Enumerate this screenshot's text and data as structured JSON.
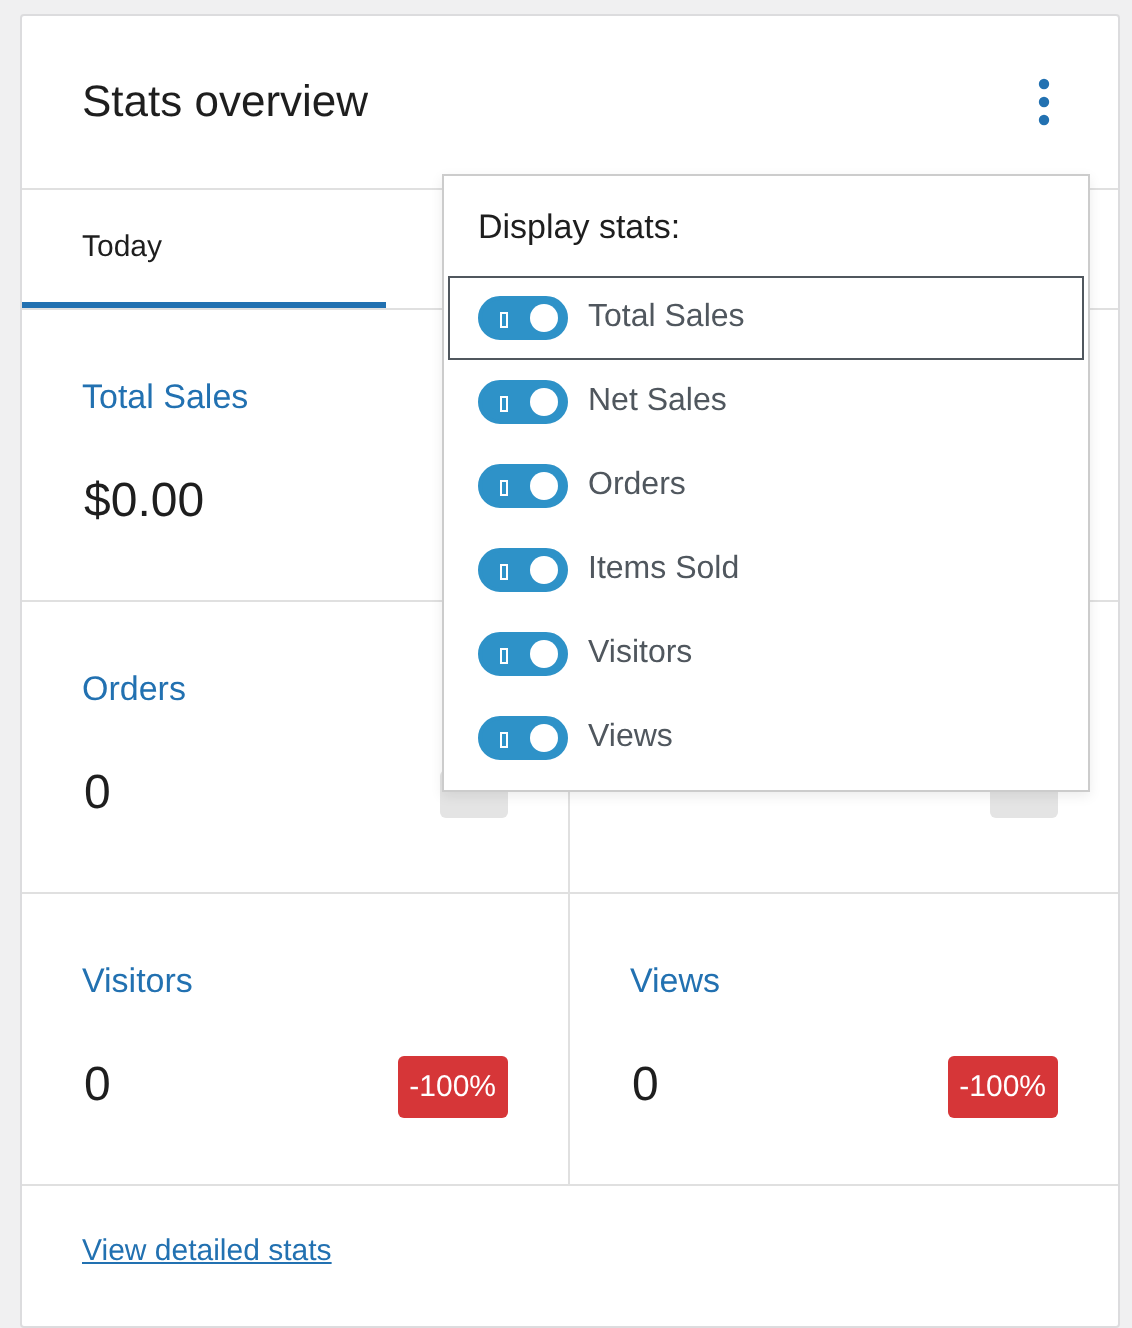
{
  "header": {
    "title": "Stats overview"
  },
  "tabs": [
    {
      "label": "Today",
      "selected": true
    }
  ],
  "stat_rows": [
    [
      {
        "label": "Total Sales",
        "value": "$0.00"
      }
    ],
    [
      {
        "label": "Orders",
        "value": "0",
        "color": "#e4e4e4"
      },
      {
        "color": "#e4e4e4"
      }
    ],
    [
      {
        "label": "Visitors",
        "value": "0",
        "badge": "-100%",
        "color": "#d63638"
      },
      {
        "label": "Views",
        "value": "0",
        "badge": "-100%",
        "color": "#d63638"
      }
    ]
  ],
  "footer_link": "View detailed stats",
  "menu": {
    "title": "Display stats:",
    "options": [
      {
        "label": "Total Sales",
        "on": true,
        "focused": true
      },
      {
        "label": "Net Sales",
        "on": true,
        "focused": false
      },
      {
        "label": "Orders",
        "on": true,
        "focused": false
      },
      {
        "label": "Items Sold",
        "on": true,
        "focused": false
      },
      {
        "label": "Visitors",
        "on": true,
        "focused": false
      },
      {
        "label": "Views",
        "on": true,
        "focused": false
      }
    ]
  }
}
